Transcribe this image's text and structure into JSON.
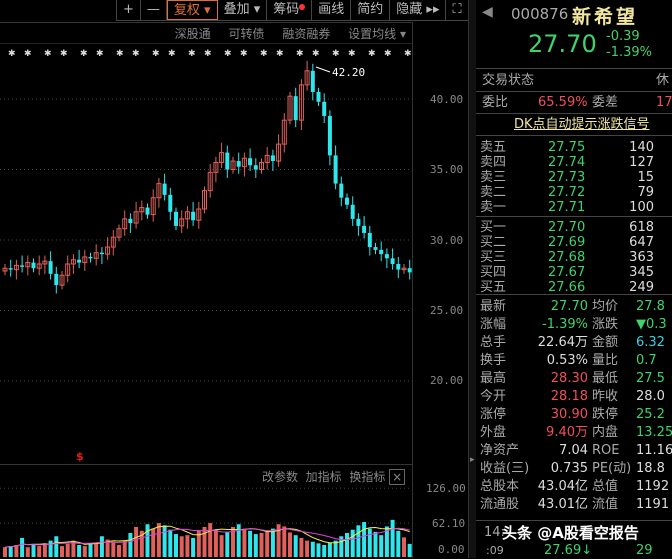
{
  "toolbar": {
    "plus": "+",
    "minus": "—",
    "fuquan": "复权 ▾",
    "diejia": "叠加 ▾",
    "chouma": "筹码",
    "huaxian": "画线",
    "jianyue": "简约",
    "yincang": "隐藏 ▸▸",
    "fullscreen": "⛶"
  },
  "subbar": {
    "items": [
      "深股通",
      "可转债",
      "融资融券",
      "设置均线 ▾"
    ]
  },
  "price_axis": [
    "40.00",
    "35.00",
    "30.00",
    "25.00",
    "20.00"
  ],
  "peak_label": "42.20",
  "volume_axis": [
    "126.00",
    "62.10",
    "0.00"
  ],
  "indicator_bar": {
    "change_params": "改参数",
    "add_indicator": "加指标",
    "switch_indicator": "换指标",
    "close": "×"
  },
  "marker": "$",
  "chart_data": {
    "type": "candlestick",
    "closes": [
      28.0,
      27.9,
      28.2,
      28.1,
      28.4,
      28.0,
      28.3,
      28.5,
      27.6,
      26.8,
      27.5,
      28.3,
      28.6,
      28.4,
      28.8,
      28.7,
      29.1,
      29.0,
      29.5,
      30.2,
      30.8,
      31.5,
      31.2,
      32.0,
      32.3,
      31.8,
      33.0,
      34.0,
      33.2,
      32.0,
      31.0,
      31.5,
      32.0,
      31.4,
      32.2,
      33.5,
      34.8,
      35.5,
      36.2,
      35.0,
      35.6,
      35.2,
      35.8,
      35.3,
      35.0,
      35.5,
      36.0,
      35.6,
      36.8,
      38.5,
      40.2,
      38.5,
      41.0,
      42.0,
      40.5,
      39.8,
      38.8,
      36.0,
      34.0,
      33.0,
      32.5,
      31.5,
      31.0,
      30.5,
      29.5,
      29.3,
      29.0,
      28.7,
      28.3,
      27.9,
      28.0,
      27.7
    ],
    "volumes": [
      18,
      20,
      22,
      35,
      18,
      22,
      20,
      25,
      30,
      38,
      20,
      24,
      30,
      22,
      20,
      25,
      26,
      38,
      32,
      28,
      22,
      30,
      44,
      55,
      48,
      60,
      52,
      62,
      58,
      50,
      42,
      38,
      40,
      35,
      48,
      55,
      62,
      50,
      40,
      45,
      55,
      60,
      52,
      48,
      42,
      44,
      46,
      52,
      60,
      56,
      45,
      40,
      35,
      30,
      28,
      25,
      22,
      26,
      30,
      38,
      44,
      50,
      58,
      64,
      52,
      46,
      40,
      56,
      68,
      48,
      36,
      24
    ],
    "ylim": [
      18,
      44
    ],
    "vol_ylim": [
      0,
      126
    ]
  },
  "quote": {
    "code": "000876",
    "name": "新希望",
    "price": "27.70",
    "change": "-0.39",
    "pct": "-1.39%"
  },
  "status": {
    "label": "交易状态",
    "value": "休"
  },
  "weibi": {
    "label": "委比",
    "value": "65.59%",
    "label2": "委差",
    "value2": "17("
  },
  "dk_link": "DK点自动提示涨跌信号",
  "asks": [
    {
      "l": "卖五",
      "p": "27.75",
      "v": "140"
    },
    {
      "l": "卖四",
      "p": "27.74",
      "v": "127"
    },
    {
      "l": "卖三",
      "p": "27.73",
      "v": "15"
    },
    {
      "l": "卖二",
      "p": "27.72",
      "v": "79"
    },
    {
      "l": "卖一",
      "p": "27.71",
      "v": "100"
    }
  ],
  "bids": [
    {
      "l": "买一",
      "p": "27.70",
      "v": "618"
    },
    {
      "l": "买二",
      "p": "27.69",
      "v": "647"
    },
    {
      "l": "买三",
      "p": "27.68",
      "v": "363"
    },
    {
      "l": "买四",
      "p": "27.67",
      "v": "345"
    },
    {
      "l": "买五",
      "p": "27.66",
      "v": "249"
    }
  ],
  "stats": [
    {
      "l1": "最新",
      "v1": "27.70",
      "c1": "g",
      "l2": "均价",
      "v2": "27.8",
      "c2": "g"
    },
    {
      "l1": "涨幅",
      "v1": "-1.39%",
      "c1": "g",
      "l2": "涨跌",
      "v2": "▼0.3",
      "c2": "g"
    },
    {
      "l1": "总手",
      "v1": "22.64万",
      "c1": "w",
      "l2": "金额",
      "v2": "6.32",
      "c2": "c"
    },
    {
      "l1": "换手",
      "v1": "0.53%",
      "c1": "w",
      "l2": "量比",
      "v2": "0.7",
      "c2": "g"
    },
    {
      "l1": "最高",
      "v1": "28.30",
      "c1": "r",
      "l2": "最低",
      "v2": "27.5",
      "c2": "g"
    },
    {
      "l1": "今开",
      "v1": "28.18",
      "c1": "r",
      "l2": "昨收",
      "v2": "28.0",
      "c2": "w"
    },
    {
      "l1": "涨停",
      "v1": "30.90",
      "c1": "r",
      "l2": "跌停",
      "v2": "25.2",
      "c2": "g"
    },
    {
      "l1": "外盘",
      "v1": "9.40万",
      "c1": "r",
      "l2": "内盘",
      "v2": "13.25",
      "c2": "g"
    },
    {
      "l1": "净资产",
      "v1": "7.04",
      "c1": "w",
      "l2": "ROE",
      "v2": "11.16",
      "c2": "w"
    },
    {
      "l1": "收益(三)",
      "v1": "0.735",
      "c1": "w",
      "l2": "PE(动)",
      "v2": "18.8",
      "c2": "w"
    },
    {
      "l1": "总股本",
      "v1": "43.04亿",
      "c1": "w",
      "l2": "总值",
      "v2": "1192",
      "c2": "w"
    },
    {
      "l1": "流通股",
      "v1": "43.01亿",
      "c1": "w",
      "l2": "流值",
      "v2": "1191",
      "c2": "w"
    }
  ],
  "tick": {
    "time": "14:",
    "time2": ":09",
    "price": "27.69↓",
    "vol": "29"
  },
  "watermark": "头条 @A股看空报告"
}
